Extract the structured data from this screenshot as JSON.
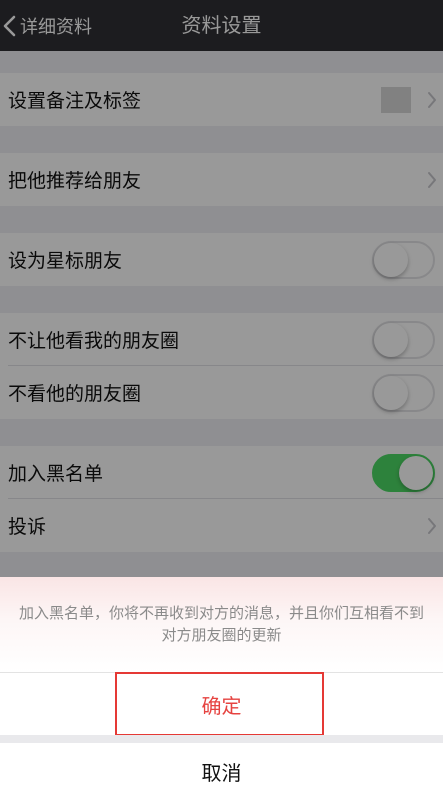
{
  "navbar": {
    "back_label": "详细资料",
    "title": "资料设置"
  },
  "sections": {
    "remark": {
      "label": "设置备注及标签"
    },
    "recommend": {
      "label": "把他推荐给朋友"
    },
    "star": {
      "label": "设为星标朋友",
      "toggle_on": false
    },
    "privacy": {
      "no_view_mine": {
        "label": "不让他看我的朋友圈",
        "toggle_on": false
      },
      "no_view_his": {
        "label": "不看他的朋友圈",
        "toggle_on": false
      }
    },
    "block": {
      "blacklist": {
        "label": "加入黑名单",
        "toggle_on": true
      },
      "report": {
        "label": "投诉"
      }
    }
  },
  "action_sheet": {
    "message": "加入黑名单，你将不再收到对方的消息，并且你们互相看不到对方朋友圈的更新",
    "confirm_label": "确定",
    "cancel_label": "取消"
  },
  "colors": {
    "navbar_bg": "#2f2f34",
    "toggle_on": "#4cd964",
    "destructive": "#e64340",
    "highlight_border": "#e53935"
  },
  "icons": {
    "back": "chevron-left-icon",
    "disclosure": "chevron-right-icon"
  }
}
